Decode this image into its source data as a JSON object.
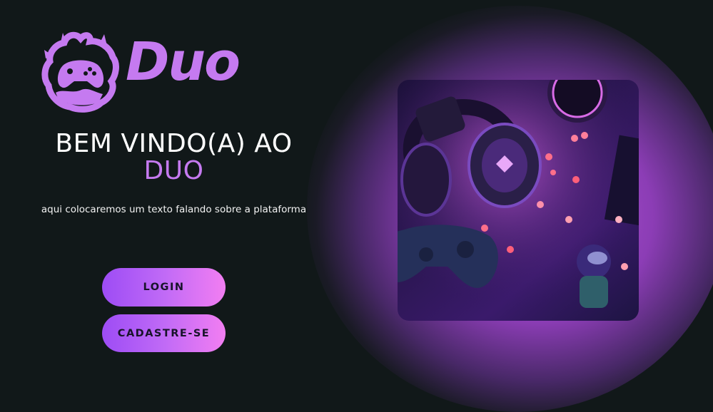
{
  "brand": {
    "name": "Duo",
    "logo_icon": "gamepad-splash-icon",
    "color": "#c57af0"
  },
  "hero": {
    "title_line1": "BEM VINDO(A) AO",
    "title_line2": "DUO",
    "description": "aqui colocaremos um texto falando sobre a plataforma"
  },
  "actions": {
    "login_label": "LOGIN",
    "signup_label": "CADASTRE-SE"
  },
  "image": {
    "subject": "gaming-setup-photo",
    "glow_color": "#c060e8"
  },
  "colors": {
    "background": "#111819",
    "button_gradient_start": "#9d4cf5",
    "button_gradient_end": "#f27ef2"
  }
}
